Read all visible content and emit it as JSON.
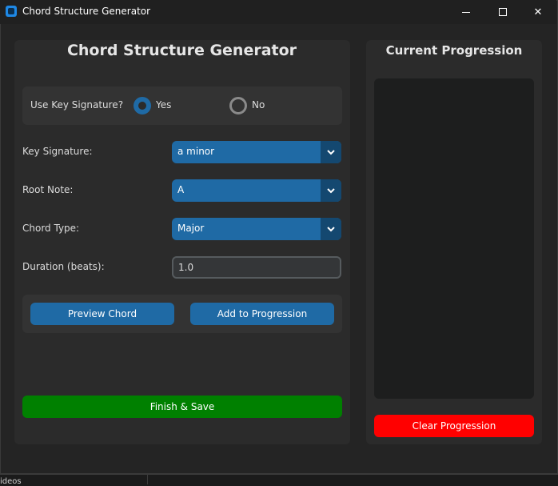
{
  "window": {
    "title": "Chord Structure Generator",
    "controls": {
      "minimize": "minimize",
      "maximize": "maximize",
      "close": "✕"
    }
  },
  "main": {
    "title": "Chord Structure Generator",
    "use_key": {
      "label": "Use Key Signature?",
      "options": [
        {
          "label": "Yes",
          "selected": true
        },
        {
          "label": "No",
          "selected": false
        }
      ]
    },
    "fields": {
      "key_signature": {
        "label": "Key Signature:",
        "value": "a minor"
      },
      "root_note": {
        "label": "Root Note:",
        "value": "A"
      },
      "chord_type": {
        "label": "Chord Type:",
        "value": "Major"
      },
      "duration": {
        "label": "Duration (beats):",
        "value": "1.0"
      }
    },
    "buttons": {
      "preview": "Preview Chord",
      "add": "Add to Progression",
      "finish": "Finish & Save"
    }
  },
  "progression": {
    "title": "Current Progression",
    "items": [],
    "clear_button": "Clear Progression"
  },
  "taskbar": {
    "partial_text": "ideos"
  },
  "colors": {
    "accent": "#1f6aa5",
    "accent_dark": "#144870",
    "finish": "#008000",
    "clear": "#ff0000",
    "panel": "#2b2b2b",
    "background": "#242424"
  },
  "icons": {
    "app": "app-icon",
    "dropdown": "chevron-down-icon"
  }
}
